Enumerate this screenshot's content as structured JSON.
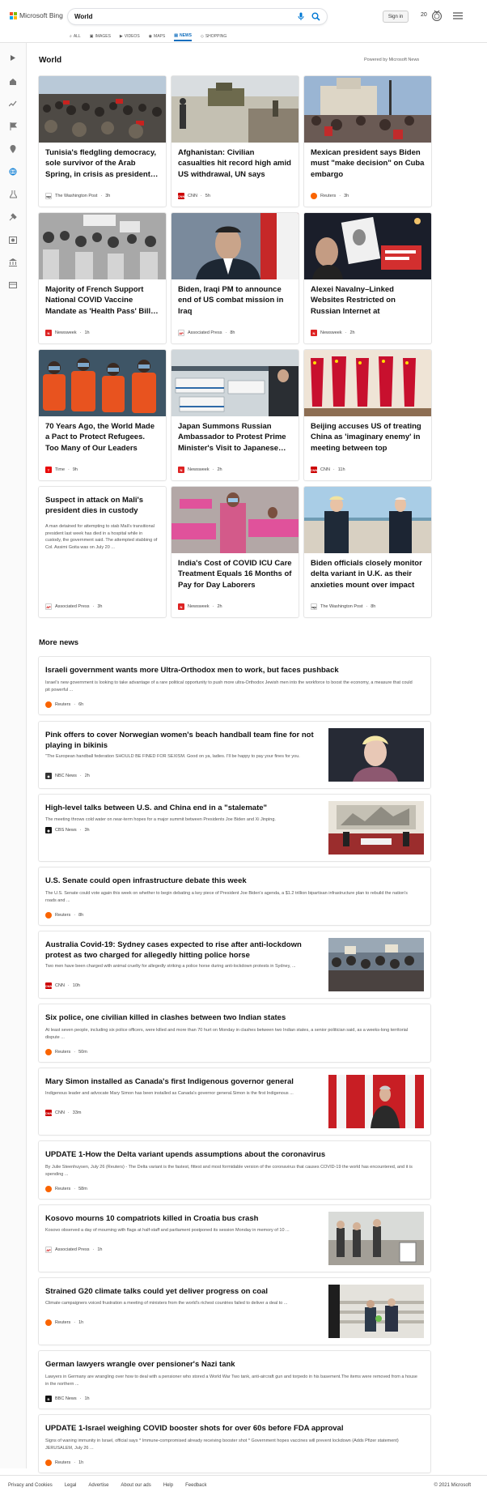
{
  "header": {
    "brand": "Microsoft Bing",
    "query": "World",
    "signin": "Sign in",
    "points": "20"
  },
  "tabs": [
    "ALL",
    "IMAGES",
    "VIDEOS",
    "MAPS",
    "NEWS",
    "SHOPPING"
  ],
  "heading": "World",
  "powered": "Powered by Microsoft News",
  "cards": [
    {
      "title": "Tunisia's fledgling democracy, sole survivor of the Arab Spring, in crisis as president…",
      "source": "The Washington Post",
      "time": "3h",
      "logo": "wp"
    },
    {
      "title": "Afghanistan: Civilian casualties hit record high amid US withdrawal, UN says",
      "source": "CNN",
      "time": "5h",
      "logo": "cnn"
    },
    {
      "title": "Mexican president says Biden must \"make decision\" on Cuba embargo",
      "source": "Reuters",
      "time": "3h",
      "logo": "reuters"
    },
    {
      "title": "Majority of French Support National COVID Vaccine Mandate as 'Health Pass' Bill…",
      "source": "Newsweek",
      "time": "1h",
      "logo": "nw"
    },
    {
      "title": "Biden, Iraqi PM to announce end of US combat mission in Iraq",
      "source": "Associated Press",
      "time": "8h",
      "logo": "ap"
    },
    {
      "title": "Alexei Navalny–Linked Websites Restricted on Russian Internet at Government's…",
      "source": "Newsweek",
      "time": "2h",
      "logo": "nw"
    },
    {
      "title": "70 Years Ago, the World Made a Pact to Protect Refugees. Too Many of Our Leaders Are…",
      "source": "Time",
      "time": "9h",
      "logo": "time"
    },
    {
      "title": "Japan Summons Russian Ambassador to Protest Prime Minister's Visit to Japanese…",
      "source": "Newsweek",
      "time": "2h",
      "logo": "nw"
    },
    {
      "title": "Beijing accuses US of treating China as 'imaginary enemy' in meeting between top diplomats",
      "source": "CNN",
      "time": "11h",
      "logo": "cnn"
    },
    {
      "title": "Suspect in attack on Mali's president dies in custody",
      "text": "A man detained for attempting to stab Mali's transitional president last week has died in a hospital while in custody, the government said. The attempted stabbing of Col. Assimi Goita was on July 20 ...",
      "source": "Associated Press",
      "time": "3h",
      "logo": "ap"
    },
    {
      "title": "India's Cost of COVID ICU Care Treatment Equals 16 Months of Pay for Day Laborers",
      "source": "Newsweek",
      "time": "2h",
      "logo": "nw"
    },
    {
      "title": "Biden officials closely monitor delta variant in U.K. as their anxieties mount over impact t…",
      "source": "The Washington Post",
      "time": "8h",
      "logo": "wp"
    }
  ],
  "more_heading": "More news",
  "news": [
    {
      "title": "Israeli government wants more Ultra-Orthodox men to work, but faces pushback",
      "desc": "Israel's new government is looking to take advantage of a rare political opportunity to push more ultra-Orthodox Jewish men into the workforce to boost the economy, a measure that could pit powerful ...",
      "source": "Reuters",
      "time": "6h",
      "logo": "reuters"
    },
    {
      "title": "Pink offers to cover Norwegian women's beach handball team fine for not playing in bikinis",
      "desc": "\"The European handball federation SHOULD BE FINED FOR SEXISM. Good on ya, ladies. I'll be happy to pay your fines for you.",
      "source": "NBC News",
      "time": "2h",
      "logo": "nbc"
    },
    {
      "title": "High-level talks between U.S. and China end in a \"stalemate\"",
      "desc": "The meeting throws cold water on near-term hopes for a major summit between Presidents Joe Biden and Xi Jinping.",
      "source": "CBS News",
      "time": "3h",
      "logo": "cbs"
    },
    {
      "title": "U.S. Senate could open infrastructure debate this week",
      "desc": "The U.S. Senate could vote again this week on whether to begin debating a key piece of President Joe Biden's agenda, a $1.2 trillion bipartisan infrastructure plan to rebuild the nation's roads and ...",
      "source": "Reuters",
      "time": "8h",
      "logo": "reuters"
    },
    {
      "title": "Australia Covid-19: Sydney cases expected to rise after anti-lockdown protest as two charged for allegedly hitting police horse",
      "desc": "Two men have been charged with animal cruelty for allegedly striking a police horse during anti-lockdown protests in Sydney, ...",
      "source": "CNN",
      "time": "10h",
      "logo": "cnn"
    },
    {
      "title": "Six police, one civilian killed in clashes between two Indian states",
      "desc": "At least seven people, including six police officers, were killed and more than 70 hurt on Monday in clashes between two Indian states, a senior politician said, as a weeks-long territorial dispute ...",
      "source": "Reuters",
      "time": "50m",
      "logo": "reuters"
    },
    {
      "title": "Mary Simon installed as Canada's first Indigenous governor general",
      "desc": "Indigenous leader and advocate Mary Simon has been installed as Canada's governor general.Simon is the first Indigenous ...",
      "source": "CNN",
      "time": "33m",
      "logo": "cnn"
    },
    {
      "title": "UPDATE 1-How the Delta variant upends assumptions about the coronavirus",
      "desc": "By Julie Steenhuysen, July 26 (Reuters) - The Delta variant is the fastest, fittest and most formidable version of the coronavirus that causes COVID-19 the world has encountered, and it is spending ...",
      "source": "Reuters",
      "time": "58m",
      "logo": "reuters"
    },
    {
      "title": "Kosovo mourns 10 compatriots killed in Croatia bus crash",
      "desc": "Kosovo observed a day of mourning with flags at half-staff and parliament postponed its session Monday in memory of 10 ...",
      "source": "Associated Press",
      "time": "1h",
      "logo": "ap"
    },
    {
      "title": "Strained G20 climate talks could yet deliver progress on coal",
      "desc": "Climate campaigners voiced frustration a meeting of ministers from the world's richest countries failed to deliver a deal to ...",
      "source": "Reuters",
      "time": "1h",
      "logo": "reuters"
    },
    {
      "title": "German lawyers wrangle over pensioner's Nazi tank",
      "desc": "Lawyers in Germany are wrangling over how to deal with a pensioner who stored a World War Two tank, anti-aircraft gun and torpedo in his basement.The items were removed from a house in the northern ...",
      "source": "BBC News",
      "time": "1h",
      "logo": "bbc"
    },
    {
      "title": "UPDATE 1-Israel weighing COVID booster shots for over 60s before FDA approval",
      "desc": "Signs of waning immunity in Israel, official says * Immune-compromised already receiving booster shot * Government hopes vaccines will prevent lockdown (Adds Pfizer statement) JERUSALEM, July 26 ...",
      "source": "Reuters",
      "time": "1h",
      "logo": "reuters"
    }
  ],
  "footer": {
    "links": [
      "Privacy and Cookies",
      "Legal",
      "Advertise",
      "About our ads",
      "Help",
      "Feedback"
    ],
    "copyright": "© 2021 Microsoft"
  }
}
